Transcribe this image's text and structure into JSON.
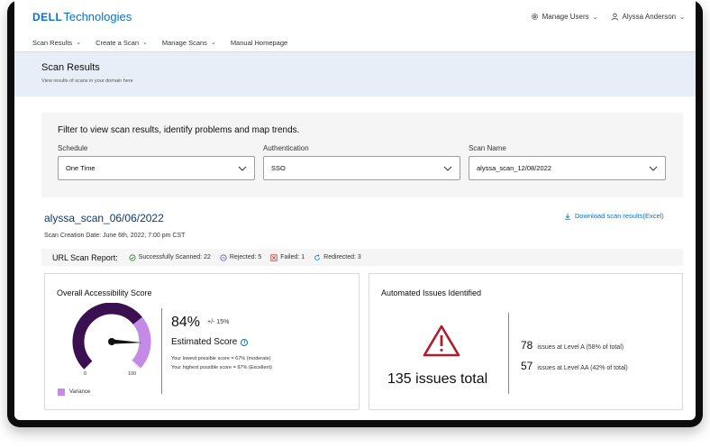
{
  "header": {
    "logo_brand": "DELL",
    "logo_text": "Technologies",
    "manage_users": "Manage Users",
    "user_name": "Alyssa Anderson"
  },
  "nav": {
    "items": [
      {
        "label": "Scan Results",
        "has_menu": true
      },
      {
        "label": "Create a Scan",
        "has_menu": true
      },
      {
        "label": "Manage Scans",
        "has_menu": true
      },
      {
        "label": "Manual Homepage",
        "has_menu": false
      }
    ]
  },
  "banner": {
    "title": "Scan Results",
    "subtitle": "View results of scans in your domain here"
  },
  "filter": {
    "heading": "Filter to view scan results, identify problems and map trends.",
    "schedule": {
      "label": "Schedule",
      "value": "One Time"
    },
    "authentication": {
      "label": "Authentication",
      "value": "SSO"
    },
    "scan_name": {
      "label": "Scan Name",
      "value": "alyssa_scan_12/08/2022"
    }
  },
  "scan": {
    "title": "alyssa_scan_06/06/2022",
    "creation_date": "Scan Creation Date: June 6th, 2022, 7:00 pm CST",
    "download_label": "Download scan results(Excel)"
  },
  "url_report": {
    "label": "URL Scan Report:",
    "successful": "Successfully Scanned: 22",
    "rejected": "Rejected: 5",
    "failed": "Failed: 1",
    "redirected": "Redirected: 3"
  },
  "score_card": {
    "title": "Overall Accessibility Score",
    "score": "84%",
    "score_value": 84,
    "variance_value": 15,
    "plus_minus": "+/- 15%",
    "estimated_label": "Estimated Score",
    "lowest": "Your lowest possible score = 67% (moderate)",
    "highest": "Your highest possible score = 97% (Excellent)",
    "gauge_min": "0",
    "gauge_max": "100",
    "variance_label": "Variance"
  },
  "issues_card": {
    "title": "Automated Issues Identified",
    "total": "135 issues total",
    "level_a_count": "78",
    "level_a_text": "issues at Level A (58% of total)",
    "level_aa_count": "57",
    "level_aa_text": "issues at Level AA (42% of total)"
  },
  "colors": {
    "brand": "#0672cb",
    "gauge_dark": "#3b1050",
    "variance": "#c48be6",
    "warning": "#b01c2e",
    "success": "#2e7d32",
    "reject": "#6b4fbb",
    "fail": "#c62828",
    "redirect": "#0672cb"
  }
}
